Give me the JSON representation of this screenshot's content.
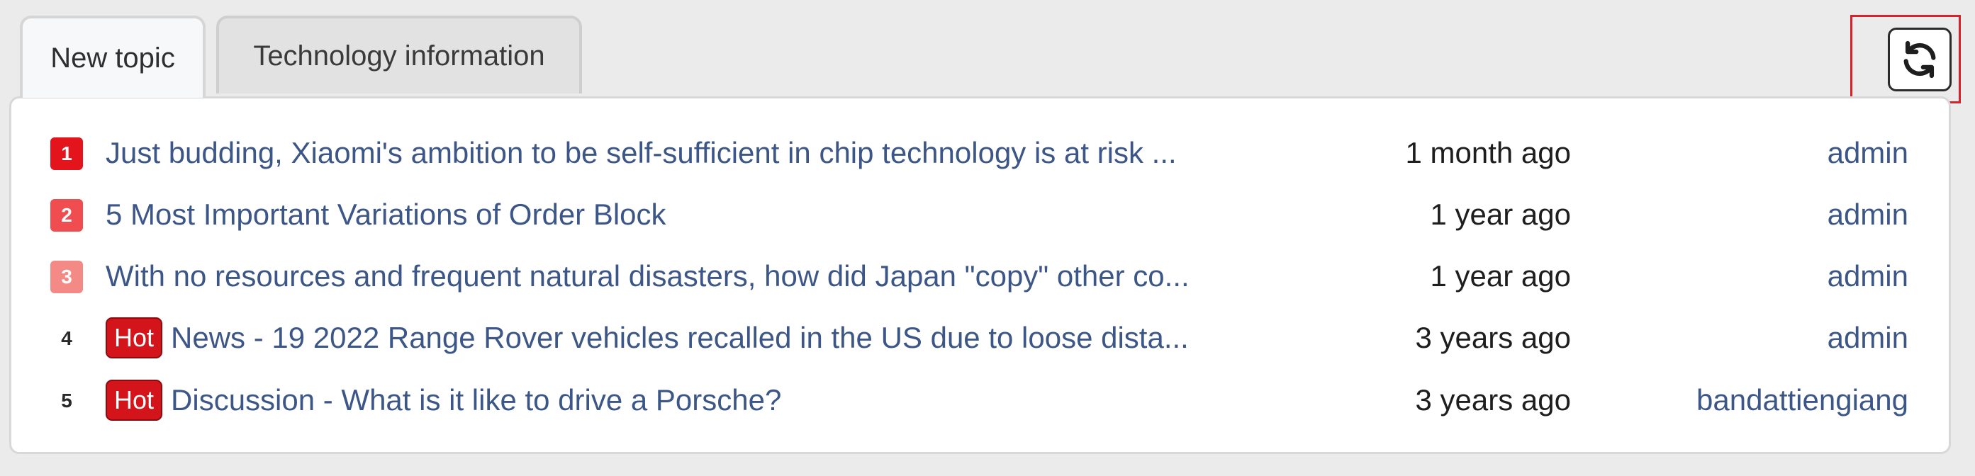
{
  "tabs": [
    {
      "label": "New topic",
      "active": true
    },
    {
      "label": "Technology information",
      "active": false
    }
  ],
  "refresh": {
    "icon": "refresh-icon"
  },
  "colors": {
    "rank1": "#e3141b",
    "rank2": "#ef4d4f",
    "rank3": "#f38a86",
    "link": "#3c5687",
    "hot": "#d3141b"
  },
  "topics": [
    {
      "rank": "1",
      "badge": "",
      "title": "Just budding, Xiaomi's ambition to be self-sufficient in chip technology is at risk ...",
      "time": "1 month ago",
      "author": "admin"
    },
    {
      "rank": "2",
      "badge": "",
      "title": "5 Most Important Variations of Order Block",
      "time": "1 year ago",
      "author": "admin"
    },
    {
      "rank": "3",
      "badge": "",
      "title": "With no resources and frequent natural disasters, how did Japan \"copy\" other co...",
      "time": "1 year ago",
      "author": "admin"
    },
    {
      "rank": "4",
      "badge": "Hot",
      "title": "News - 19 2022 Range Rover vehicles recalled in the US due to loose dista...",
      "time": "3 years ago",
      "author": "admin"
    },
    {
      "rank": "5",
      "badge": "Hot",
      "title": "Discussion - What is it like to drive a Porsche?",
      "time": "3 years ago",
      "author": "bandattiengiang"
    }
  ]
}
